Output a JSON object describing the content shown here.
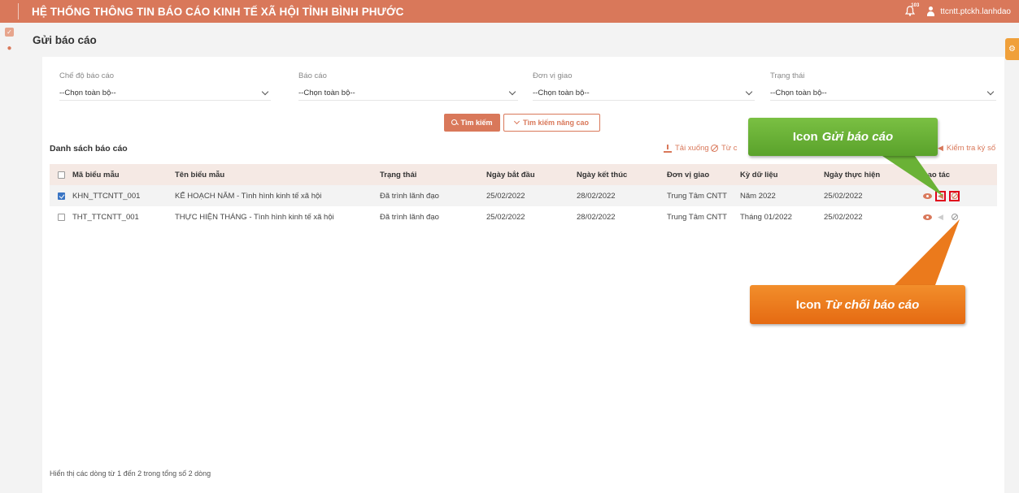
{
  "app": {
    "title": "HỆ THỐNG THÔNG TIN BÁO CÁO KINH TẾ XÃ HỘI TỈNH BÌNH PHƯỚC",
    "notif_badge": "103",
    "username": "ttcntt.ptckh.lanhdao"
  },
  "page_title": "Gửi báo cáo",
  "filters": [
    {
      "label": "Chế độ báo cáo",
      "value": "--Chọn toàn bộ--"
    },
    {
      "label": "Báo cáo",
      "value": "--Chọn toàn bộ--"
    },
    {
      "label": "Đơn vị giao",
      "value": "--Chọn toàn bộ--"
    },
    {
      "label": "Trạng thái",
      "value": "--Chọn toàn bộ--"
    }
  ],
  "buttons": {
    "search": "Tìm kiếm",
    "advanced_search": "Tìm kiếm nâng cao"
  },
  "list": {
    "title": "Danh sách báo cáo",
    "download": "Tải xuống",
    "reject": "Từ c",
    "check_signature": "Kiểm tra ký số"
  },
  "table": {
    "headers": [
      "Mã biểu mẫu",
      "Tên biểu mẫu",
      "Trạng thái",
      "Ngày bắt đầu",
      "Ngày kết thúc",
      "Đơn vị giao",
      "Kỳ dữ liệu",
      "Ngày thực hiện",
      "Thao tác"
    ],
    "rows": [
      {
        "checked": true,
        "code": "KHN_TTCNTT_001",
        "name": "KẾ HOẠCH NĂM - Tình hình kinh tế xã hội",
        "status": "Đã trình lãnh đạo",
        "start": "25/02/2022",
        "end": "28/02/2022",
        "unit": "Trung Tâm CNTT",
        "period": "Năm 2022",
        "done": "25/02/2022"
      },
      {
        "checked": false,
        "code": "THT_TTCNTT_001",
        "name": "THỰC HIỆN THÁNG - Tình hình kinh tế xã hội",
        "status": "Đã trình lãnh đạo",
        "start": "25/02/2022",
        "end": "28/02/2022",
        "unit": "Trung Tâm CNTT",
        "period": "Tháng 01/2022",
        "done": "25/02/2022"
      }
    ]
  },
  "footer": "Hiển thị các dòng từ 1 đến 2 trong tổng số 2 dòng",
  "callouts": {
    "send_prefix": "Icon",
    "send_name": "Gửi báo cáo",
    "reject_prefix": "Icon",
    "reject_name": "Từ chối báo cáo"
  },
  "colors": {
    "brand": "#d9785a",
    "callout_green": "#6ab236",
    "callout_orange": "#eb7a1c",
    "highlight_box": "#e0001b"
  },
  "icons": [
    "logo-icon",
    "bell-icon",
    "user-icon",
    "report-icon",
    "palette-icon",
    "gear-icon",
    "search-icon",
    "chevron-down-icon",
    "download-icon",
    "ban-icon",
    "send-icon",
    "eye-icon"
  ]
}
